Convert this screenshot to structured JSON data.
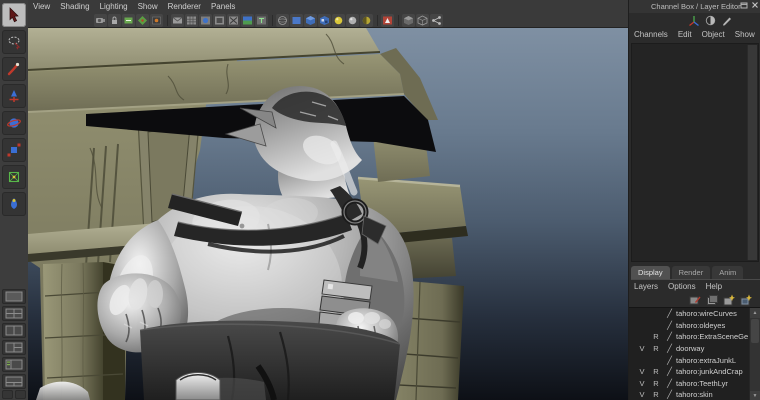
{
  "viewport_panel": {
    "menu": [
      "View",
      "Shading",
      "Lighting",
      "Show",
      "Renderer",
      "Panels"
    ],
    "toolbar_icons": [
      "select-camera-icon",
      "lock-camera-icon",
      "camera-attributes-icon",
      "bookmark-icon",
      "image-plane-icon",
      "pan-zoom-icon",
      "grid-icon",
      "film-gate-icon",
      "resolution-gate-icon",
      "gate-mask-icon",
      "field-chart-icon",
      "safe-title-icon",
      "wireframe-icon",
      "flat-shade-icon",
      "shaded-icon",
      "textured-icon",
      "use-default-lighting-icon",
      "all-lights-icon",
      "shadows-icon",
      "isolate-select-icon",
      "xray-icon",
      "backface-culling-icon",
      "share-icon"
    ]
  },
  "toolbox": {
    "tools": [
      "select-tool",
      "lasso-tool",
      "paint-select-tool",
      "move-tool",
      "rotate-tool",
      "scale-tool",
      "universal-manipulator-tool",
      "soft-modification-tool"
    ],
    "layouts": [
      "layout-single-pane-button",
      "layout-four-pane-button",
      "layout-two-pane-button",
      "layout-three-pane-button",
      "layout-outliner-persp-button",
      "layout-split-bottom-button"
    ]
  },
  "channel_box": {
    "title": "Channel Box / Layer Editor",
    "window_controls": [
      "float-icon",
      "close-icon"
    ],
    "header_icons": [
      "xyz-axes-icon",
      "speed-icon",
      "pencil-icon"
    ],
    "menu": [
      "Channels",
      "Edit",
      "Object",
      "Show"
    ]
  },
  "layer_editor": {
    "tabs": [
      {
        "label": "Display",
        "active": true
      },
      {
        "label": "Render",
        "active": false
      },
      {
        "label": "Anim",
        "active": false
      }
    ],
    "menu": [
      "Layers",
      "Options",
      "Help"
    ],
    "toolbar_icons": [
      "layer-pen-icon",
      "layer-box-icon",
      "new-empty-layer-icon",
      "new-layer-from-selected-icon"
    ],
    "layers": [
      {
        "visible": "",
        "type": "",
        "name": "tahoro:wireCurves"
      },
      {
        "visible": "",
        "type": "",
        "name": "tahoro:oldeyes"
      },
      {
        "visible": "",
        "type": "R",
        "name": "tahoro:ExtraSceneGe"
      },
      {
        "visible": "V",
        "type": "R",
        "name": "doorway"
      },
      {
        "visible": "",
        "type": "",
        "name": "tahoro:extraJunkL"
      },
      {
        "visible": "V",
        "type": "R",
        "name": "tahoro:junkAndCrap"
      },
      {
        "visible": "V",
        "type": "R",
        "name": "tahoro:TeethLyr"
      },
      {
        "visible": "V",
        "type": "R",
        "name": "tahoro:skin"
      }
    ]
  },
  "scene": {
    "description": "Gray shaded ogre character looking up, standing in a carved stone doorway",
    "objects": [
      "ogre-model",
      "stone-doorway"
    ]
  },
  "colors": {
    "ui_bg": "#3a3a3a",
    "panel_bg": "#2b2b2b",
    "list_bg": "#202020",
    "tab_active": "#515151",
    "viewport_top": "#7f90a3",
    "viewport_bottom": "#0d1016",
    "stone": "#8f8d71",
    "model_metal": "#b9b9b9"
  }
}
